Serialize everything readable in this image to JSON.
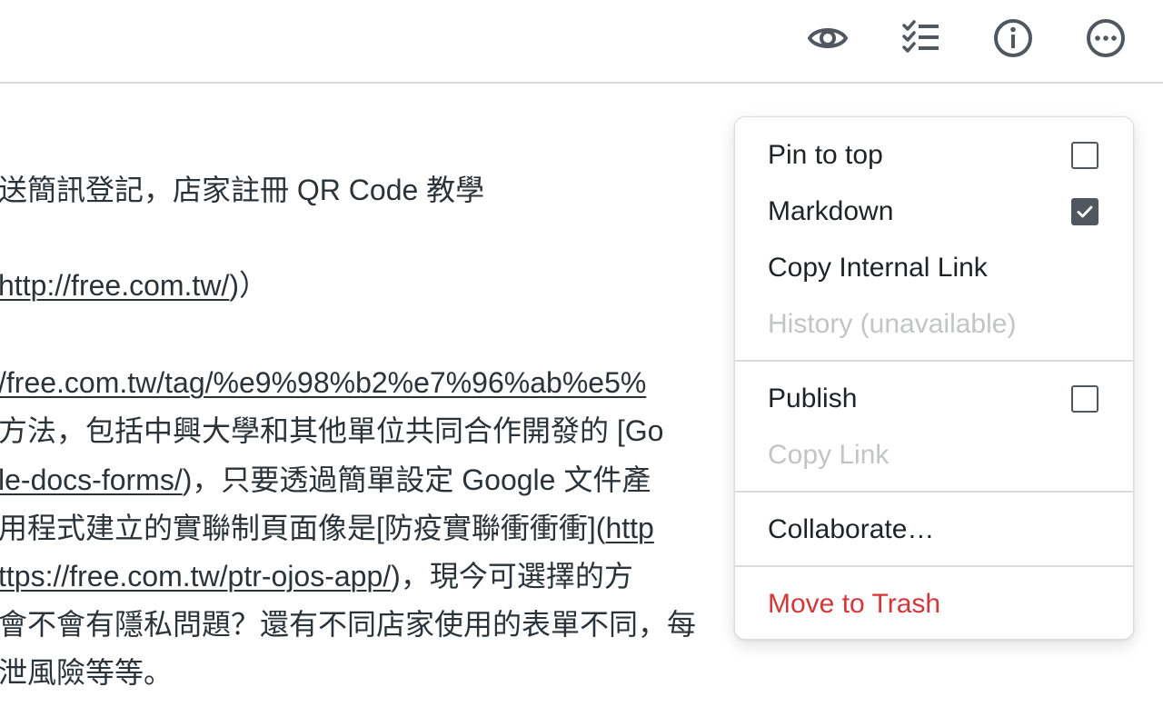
{
  "toolbar": {
    "icons": [
      "eye-icon",
      "checklist-icon",
      "info-icon",
      "more-icon"
    ]
  },
  "editor": {
    "lines": [
      {
        "text": "送簡訊登記，店家註冊 QR Code 教學"
      },
      {
        "pre": "",
        "link": "http://free.com.tw/",
        "post": ")）"
      },
      {
        "pre": "",
        "link": "/free.com.tw/tag/%e9%98%b2%e7%96%ab%e5%",
        "post": ""
      },
      {
        "text": "方法，包括中興大學和其他單位共同合作開發的 [Go"
      },
      {
        "pre": "",
        "link": "le-docs-forms/",
        "post": ")，只要透過簡單設定 Google 文件產"
      },
      {
        "pre": "用程式建立的實聯制頁面像是[防疫實聯衝衝衝](",
        "link": "http",
        "post": ""
      },
      {
        "pre": "",
        "link": "ttps://free.com.tw/ptr-ojos-app/",
        "post": ")，現今可選擇的方"
      },
      {
        "text": "會不會有隱私問題？還有不同店家使用的表單不同，每"
      },
      {
        "text": "泄風險等等。"
      }
    ]
  },
  "menu": {
    "pin_to_top": {
      "label": "Pin to top",
      "checked": false
    },
    "markdown": {
      "label": "Markdown",
      "checked": true
    },
    "copy_internal_link": {
      "label": "Copy Internal Link"
    },
    "history": {
      "label": "History (unavailable)",
      "disabled": true
    },
    "publish": {
      "label": "Publish",
      "checked": false
    },
    "copy_link": {
      "label": "Copy Link",
      "disabled": true
    },
    "collaborate": {
      "label": "Collaborate…"
    },
    "move_to_trash": {
      "label": "Move to Trash",
      "color": "#d63638"
    }
  },
  "colors": {
    "text": "#2c3338",
    "icon": "#50575e",
    "disabled": "#c3c4c7",
    "danger": "#d63638",
    "border": "#dcdcde"
  }
}
